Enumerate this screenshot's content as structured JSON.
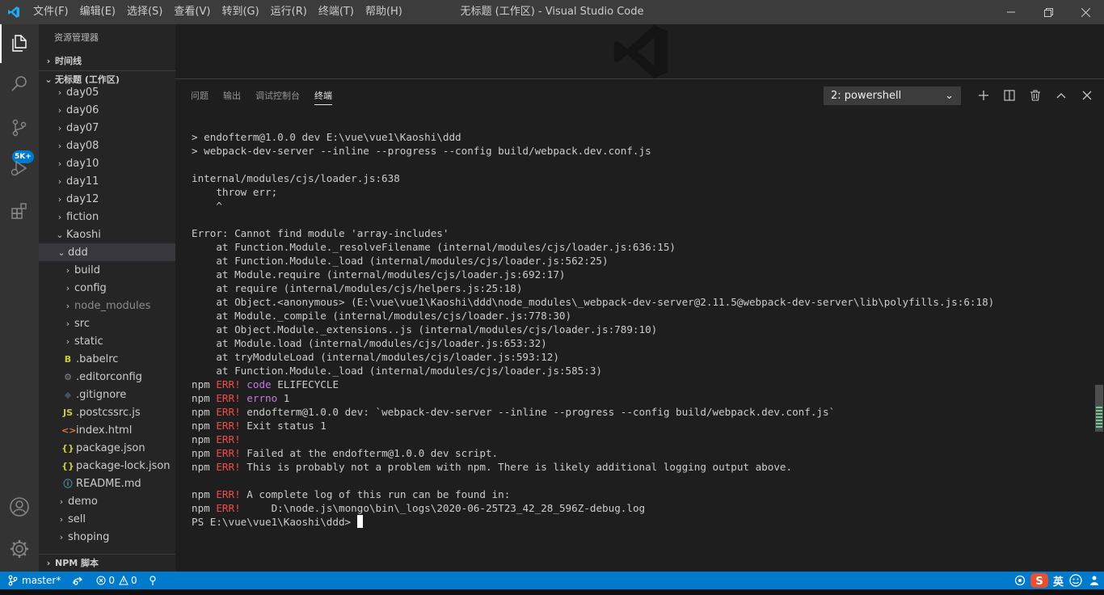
{
  "titlebar": {
    "menu": [
      "文件(F)",
      "编辑(E)",
      "选择(S)",
      "查看(V)",
      "转到(G)",
      "运行(R)",
      "终端(T)",
      "帮助(H)"
    ],
    "title": "无标题 (工作区) - Visual Studio Code"
  },
  "activitybar": {
    "icons": [
      "explorer-icon",
      "search-icon",
      "source-control-icon",
      "run-debug-icon",
      "extensions-icon",
      "account-icon",
      "settings-gear-icon"
    ],
    "scm_badge": "5K+"
  },
  "sidebar": {
    "title": "资源管理器",
    "timeline_label": "时间线",
    "workspace_label": "无标题 (工作区)",
    "npm_label": "NPM 脚本",
    "tree": [
      {
        "label": "day05",
        "depth": 1,
        "kind": "folder"
      },
      {
        "label": "day06",
        "depth": 1,
        "kind": "folder"
      },
      {
        "label": "day07",
        "depth": 1,
        "kind": "folder"
      },
      {
        "label": "day08",
        "depth": 1,
        "kind": "folder"
      },
      {
        "label": "day10",
        "depth": 1,
        "kind": "folder"
      },
      {
        "label": "day11",
        "depth": 1,
        "kind": "folder"
      },
      {
        "label": "day12",
        "depth": 1,
        "kind": "folder"
      },
      {
        "label": "fiction",
        "depth": 1,
        "kind": "folder"
      },
      {
        "label": "Kaoshi",
        "depth": 1,
        "kind": "folder-open"
      },
      {
        "label": "ddd",
        "depth": 2,
        "kind": "folder-open",
        "selected": true
      },
      {
        "label": "build",
        "depth": 3,
        "kind": "folder"
      },
      {
        "label": "config",
        "depth": 3,
        "kind": "folder"
      },
      {
        "label": "node_modules",
        "depth": 3,
        "kind": "folder",
        "dim": true
      },
      {
        "label": "src",
        "depth": 3,
        "kind": "folder"
      },
      {
        "label": "static",
        "depth": 3,
        "kind": "folder"
      },
      {
        "label": ".babelrc",
        "depth": 3,
        "kind": "file",
        "icon": "B",
        "color": "#cbcb41"
      },
      {
        "label": ".editorconfig",
        "depth": 3,
        "kind": "file",
        "icon": "⚙",
        "color": "#8a8a8a"
      },
      {
        "label": ".gitignore",
        "depth": 3,
        "kind": "file",
        "icon": "◆",
        "color": "#41535b"
      },
      {
        "label": ".postcssrc.js",
        "depth": 3,
        "kind": "file",
        "icon": "JS",
        "color": "#cbcb41"
      },
      {
        "label": "index.html",
        "depth": 3,
        "kind": "file",
        "icon": "<>",
        "color": "#e37933"
      },
      {
        "label": "package.json",
        "depth": 3,
        "kind": "file",
        "icon": "{}",
        "color": "#cbcb41"
      },
      {
        "label": "package-lock.json",
        "depth": 3,
        "kind": "file",
        "icon": "{}",
        "color": "#cbcb41"
      },
      {
        "label": "README.md",
        "depth": 3,
        "kind": "file",
        "icon": "ⓘ",
        "color": "#519aba"
      },
      {
        "label": "demo",
        "depth": 2,
        "kind": "folder"
      },
      {
        "label": "sell",
        "depth": 2,
        "kind": "folder"
      },
      {
        "label": "shoping",
        "depth": 2,
        "kind": "folder"
      }
    ]
  },
  "panel": {
    "tabs": [
      "问题",
      "输出",
      "调试控制台",
      "终端"
    ],
    "active_tab": 3,
    "terminal_select": "2: powershell",
    "actions": [
      "add-icon",
      "split-icon",
      "trash-icon",
      "maximize-icon",
      "close-icon"
    ]
  },
  "terminal": {
    "lines": [
      [
        [
          "",
          "> endofterm@1.0.0 dev E:\\vue\\vue1\\Kaoshi\\ddd"
        ]
      ],
      [
        [
          "",
          "> webpack-dev-server --inline --progress --config build/webpack.dev.conf.js"
        ]
      ],
      [
        [
          "",
          ""
        ]
      ],
      [
        [
          "",
          "internal/modules/cjs/loader.js:638"
        ]
      ],
      [
        [
          "",
          "    throw err;"
        ]
      ],
      [
        [
          "",
          "    ^"
        ]
      ],
      [
        [
          "",
          ""
        ]
      ],
      [
        [
          "",
          "Error: Cannot find module 'array-includes'"
        ]
      ],
      [
        [
          "",
          "    at Function.Module._resolveFilename (internal/modules/cjs/loader.js:636:15)"
        ]
      ],
      [
        [
          "",
          "    at Function.Module._load (internal/modules/cjs/loader.js:562:25)"
        ]
      ],
      [
        [
          "",
          "    at Module.require (internal/modules/cjs/loader.js:692:17)"
        ]
      ],
      [
        [
          "",
          "    at require (internal/modules/cjs/helpers.js:25:18)"
        ]
      ],
      [
        [
          "",
          "    at Object.<anonymous> (E:\\vue\\vue1\\Kaoshi\\ddd\\node_modules\\_webpack-dev-server@2.11.5@webpack-dev-server\\lib\\polyfills.js:6:18)"
        ]
      ],
      [
        [
          "",
          "    at Module._compile (internal/modules/cjs/loader.js:778:30)"
        ]
      ],
      [
        [
          "",
          "    at Object.Module._extensions..js (internal/modules/cjs/loader.js:789:10)"
        ]
      ],
      [
        [
          "",
          "    at Module.load (internal/modules/cjs/loader.js:653:32)"
        ]
      ],
      [
        [
          "",
          "    at tryModuleLoad (internal/modules/cjs/loader.js:593:12)"
        ]
      ],
      [
        [
          "",
          "    at Function.Module._load (internal/modules/cjs/loader.js:585:3)"
        ]
      ],
      [
        [
          "",
          "npm "
        ],
        [
          "err",
          "ERR!"
        ],
        [
          "",
          " "
        ],
        [
          "kw",
          "code"
        ],
        [
          "",
          " ELIFECYCLE"
        ]
      ],
      [
        [
          "",
          "npm "
        ],
        [
          "err",
          "ERR!"
        ],
        [
          "",
          " "
        ],
        [
          "kw",
          "errno"
        ],
        [
          "",
          " 1"
        ]
      ],
      [
        [
          "",
          "npm "
        ],
        [
          "err",
          "ERR!"
        ],
        [
          "",
          " endofterm@1.0.0 dev: `webpack-dev-server --inline --progress --config build/webpack.dev.conf.js`"
        ]
      ],
      [
        [
          "",
          "npm "
        ],
        [
          "err",
          "ERR!"
        ],
        [
          "",
          " Exit status 1"
        ]
      ],
      [
        [
          "",
          "npm "
        ],
        [
          "err",
          "ERR!"
        ]
      ],
      [
        [
          "",
          "npm "
        ],
        [
          "err",
          "ERR!"
        ],
        [
          "",
          " Failed at the endofterm@1.0.0 dev script."
        ]
      ],
      [
        [
          "",
          "npm "
        ],
        [
          "err",
          "ERR!"
        ],
        [
          "",
          " This is probably not a problem with npm. There is likely additional logging output above."
        ]
      ],
      [
        [
          "",
          ""
        ]
      ],
      [
        [
          "",
          "npm "
        ],
        [
          "err",
          "ERR!"
        ],
        [
          "",
          " A complete log of this run can be found in:"
        ]
      ],
      [
        [
          "",
          "npm "
        ],
        [
          "err",
          "ERR!"
        ],
        [
          "",
          "     D:\\node.js\\mongo\\bin\\_logs\\2020-06-25T23_42_28_596Z-debug.log"
        ]
      ],
      [
        [
          "",
          "PS E:\\vue\\vue1\\Kaoshi\\ddd>"
        ]
      ]
    ]
  },
  "statusbar": {
    "branch": "master*",
    "errors": "0",
    "warnings": "0",
    "ime": "英"
  }
}
